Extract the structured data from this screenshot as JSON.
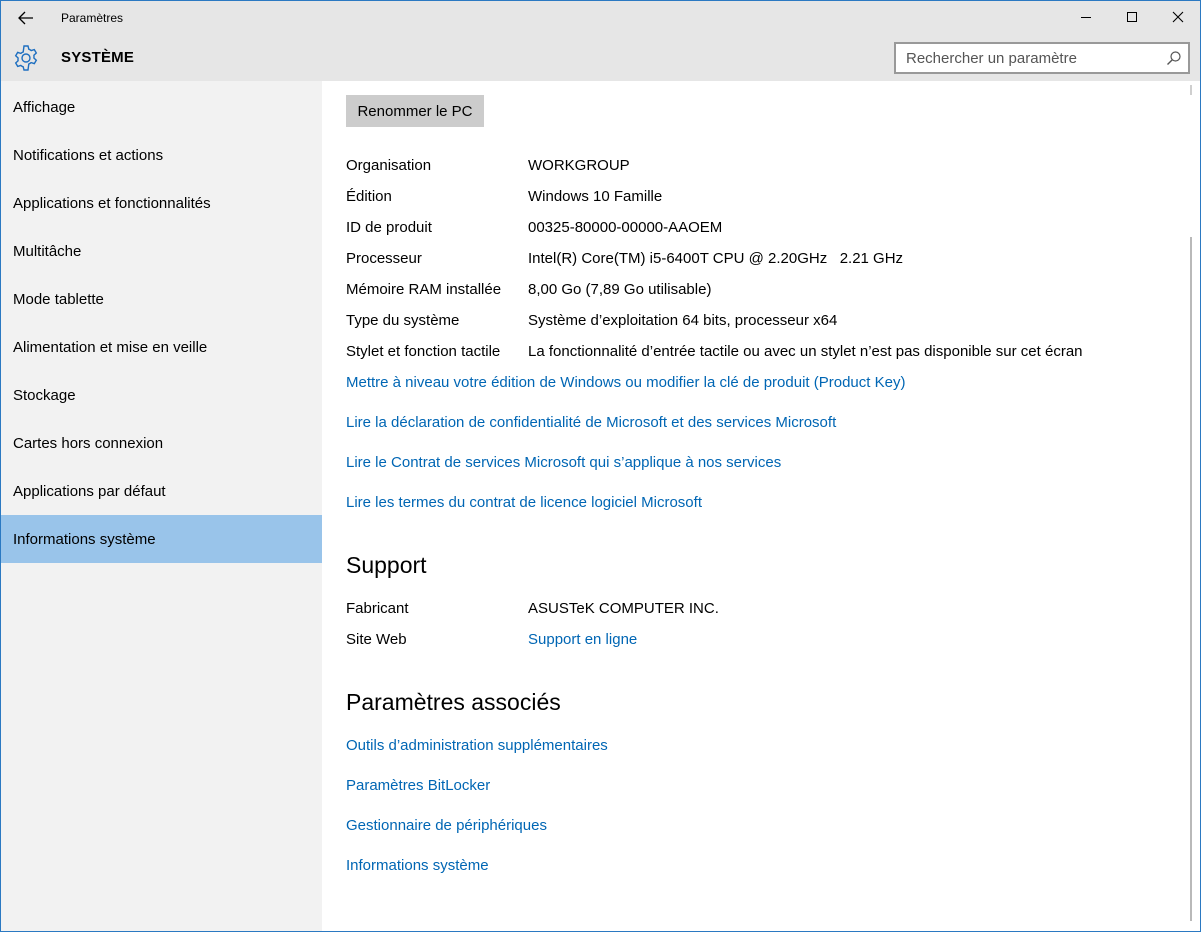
{
  "window": {
    "app_title": "Paramètres",
    "section_title": "SYSTÈME",
    "accent_color": "#99c4ea",
    "link_color": "#0066b4"
  },
  "search": {
    "placeholder": "Rechercher un paramètre"
  },
  "sidebar": {
    "items": [
      {
        "label": "Affichage"
      },
      {
        "label": "Notifications et actions"
      },
      {
        "label": "Applications et fonctionnalités"
      },
      {
        "label": "Multitâche"
      },
      {
        "label": "Mode tablette"
      },
      {
        "label": "Alimentation et mise en veille"
      },
      {
        "label": "Stockage"
      },
      {
        "label": "Cartes hors connexion"
      },
      {
        "label": "Applications par défaut"
      },
      {
        "label": "Informations système"
      }
    ],
    "active_index": 9
  },
  "main": {
    "rename_button": "Renommer le PC",
    "info": [
      {
        "label": "Organisation",
        "value": "WORKGROUP"
      },
      {
        "label": "Édition",
        "value": "Windows 10 Famille"
      },
      {
        "label": "ID de produit",
        "value": "00325-80000-00000-AAOEM"
      },
      {
        "label": "Processeur",
        "value": "Intel(R) Core(TM) i5-6400T CPU @ 2.20GHz   2.21 GHz"
      },
      {
        "label": "Mémoire RAM installée",
        "value": "8,00 Go (7,89 Go utilisable)"
      },
      {
        "label": "Type du système",
        "value": "Système d’exploitation 64 bits, processeur x64"
      },
      {
        "label": "Stylet et fonction tactile",
        "value": "La fonctionnalité d’entrée tactile ou avec un stylet n’est pas disponible sur cet écran"
      }
    ],
    "links": [
      "Mettre à niveau votre édition de Windows ou modifier la clé de produit (Product Key)",
      "Lire la déclaration de confidentialité de Microsoft et des services Microsoft",
      "Lire le Contrat de services Microsoft qui s’applique à nos services",
      "Lire les termes du contrat de licence logiciel Microsoft"
    ],
    "support": {
      "heading": "Support",
      "manufacturer_label": "Fabricant",
      "manufacturer_value": "ASUSTeK COMPUTER INC.",
      "website_label": "Site Web",
      "website_value": "Support en ligne"
    },
    "related": {
      "heading": "Paramètres associés",
      "links": [
        "Outils d’administration supplémentaires",
        "Paramètres BitLocker",
        "Gestionnaire de périphériques",
        "Informations système"
      ]
    }
  }
}
